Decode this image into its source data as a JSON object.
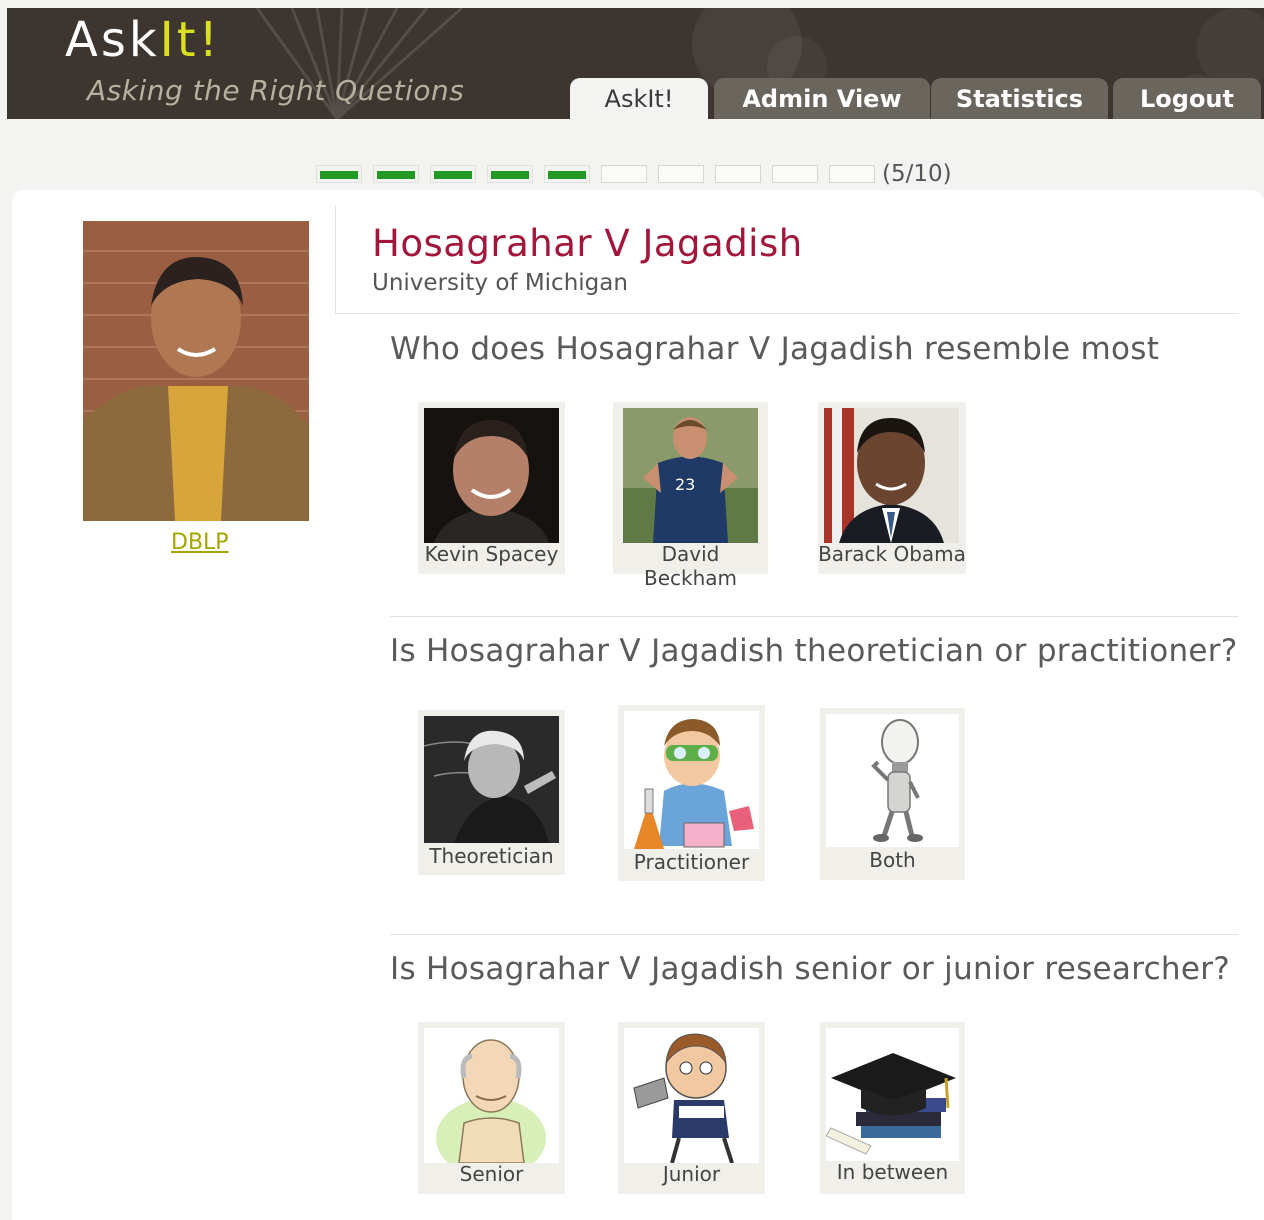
{
  "header": {
    "logo_main": "Ask",
    "logo_accent": "It!",
    "tagline": "Asking the Right Quetions",
    "tabs": [
      {
        "label": "AskIt!",
        "active": true
      },
      {
        "label": "Admin View",
        "active": false
      },
      {
        "label": "Statistics",
        "active": false
      },
      {
        "label": "Logout",
        "active": false
      }
    ]
  },
  "progress": {
    "completed": 5,
    "total": 10,
    "label": "(5/10)"
  },
  "profile": {
    "name": "Hosagrahar V Jagadish",
    "affiliation": "University of Michigan",
    "link_label": "DBLP"
  },
  "questions": [
    {
      "text": "Who does Hosagrahar V Jagadish resemble most",
      "choices": [
        {
          "label": "Kevin Spacey",
          "icon": "kevin-spacey-photo"
        },
        {
          "label": "David Beckham",
          "icon": "david-beckham-photo"
        },
        {
          "label": "Barack Obama",
          "icon": "barack-obama-photo"
        }
      ]
    },
    {
      "text": "Is Hosagrahar V Jagadish theoretician or practitioner?",
      "choices": [
        {
          "label": "Theoretician",
          "icon": "einstein-chalkboard-photo"
        },
        {
          "label": "Practitioner",
          "icon": "scientist-cartoon"
        },
        {
          "label": "Both",
          "icon": "lightbulb-figure"
        }
      ]
    },
    {
      "text": "Is Hosagrahar V Jagadish senior or junior researcher?",
      "choices": [
        {
          "label": "Senior",
          "icon": "old-man-cartoon"
        },
        {
          "label": "Junior",
          "icon": "boy-director-cartoon"
        },
        {
          "label": "In between",
          "icon": "graduation-cap"
        }
      ]
    }
  ],
  "colors": {
    "header_bg": "#3c3530",
    "tab_inactive": "#6a665d",
    "name_color": "#a3163a",
    "progress_done": "#229922",
    "link_color": "#a4a600"
  }
}
